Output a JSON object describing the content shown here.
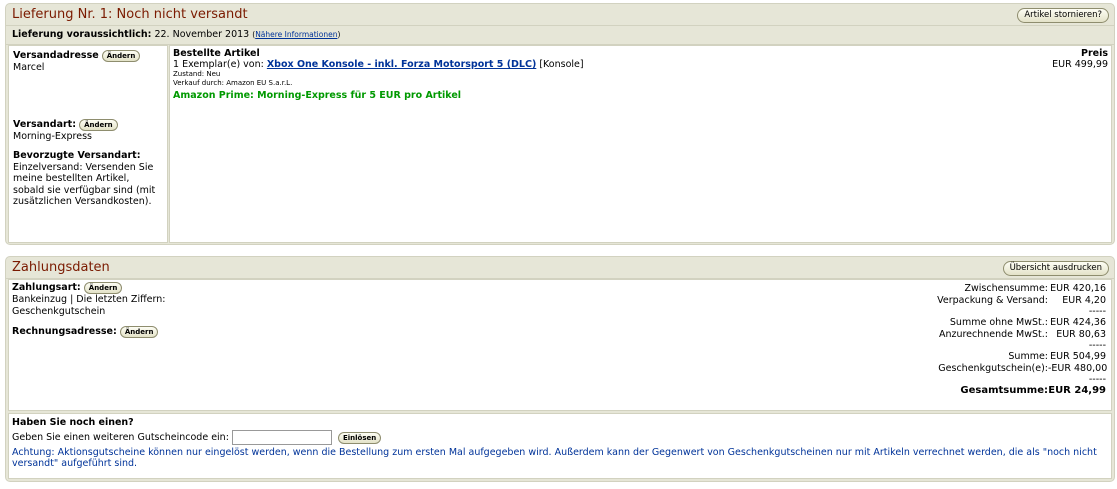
{
  "shipment": {
    "title": "Lieferung Nr. 1: Noch nicht versandt",
    "cancel_button": "Artikel stornieren?",
    "expected_label": "Lieferung voraussichtlich:",
    "expected_date": "22. November 2013",
    "more_info_open": "(",
    "more_info_link": "Nähere Informationen",
    "more_info_close": ")",
    "address_label": "Versandadresse",
    "change_label": "Ändern",
    "address_name": "Marcel",
    "shipping_type_label": "Versandart:",
    "shipping_type_value": "Morning-Express",
    "preferred_label": "Bevorzugte Versandart:",
    "preferred_lines": [
      "Einzelversand: Versenden Sie",
      "meine bestellten Artikel,",
      "sobald sie verfügbar sind (mit",
      "zusätzlichen Versandkosten)."
    ],
    "ordered_header": "Bestellte Artikel",
    "price_header": "Preis",
    "item": {
      "qty_text": "1 Exemplar(e) von:",
      "name": "Xbox One Konsole - inkl. Forza Motorsport 5 (DLC)",
      "category": "[Konsole]",
      "condition": "Zustand: Neu",
      "seller": "Verkauf durch: Amazon EU S.a.r.L.",
      "prime_note": "Amazon Prime: Morning-Express für 5 EUR pro Artikel",
      "price": "EUR 499,99"
    }
  },
  "payment": {
    "title": "Zahlungsdaten",
    "print_button": "Übersicht ausdrucken",
    "method_label": "Zahlungsart:",
    "change_label": "Ändern",
    "method_line1": "Bankeinzug | Die letzten Ziffern:",
    "method_line2": "Geschenkgutschein",
    "billing_label": "Rechnungsadresse:",
    "summary": [
      {
        "label": "Zwischensumme:",
        "value": "EUR 420,16"
      },
      {
        "label": "Verpackung & Versand:",
        "value": "EUR 4,20"
      },
      {
        "dash": "-----"
      },
      {
        "label": "Summe ohne MwSt.:",
        "value": "EUR 424,36"
      },
      {
        "label": "Anzurechnende MwSt.:",
        "value": "EUR 80,63"
      },
      {
        "dash": "-----"
      },
      {
        "label": "Summe:",
        "value": "EUR 504,99"
      },
      {
        "label": "Geschenkgutschein(e):",
        "value": "-EUR 480,00"
      },
      {
        "dash": "-----"
      }
    ],
    "total_label": "Gesamtsumme:",
    "total_value": "EUR 24,99",
    "voucher_heading": "Haben Sie noch einen?",
    "voucher_prompt": "Geben Sie einen weiteren Gutscheincode ein:",
    "voucher_value": "",
    "redeem_button": "Einlösen",
    "notice": "Achtung: Aktionsgutscheine können nur eingelöst werden, wenn die Bestellung zum ersten Mal aufgegeben wird. Außerdem kann der Gegenwert von Geschenkgutscheinen nur mit Artikeln verrechnet werden, die als \"noch nicht versandt\" aufgeführt sind."
  },
  "colors": {
    "panel_bg": "#e6e6d7",
    "title": "#7a1a00",
    "link": "#003399",
    "prime": "#009900"
  }
}
